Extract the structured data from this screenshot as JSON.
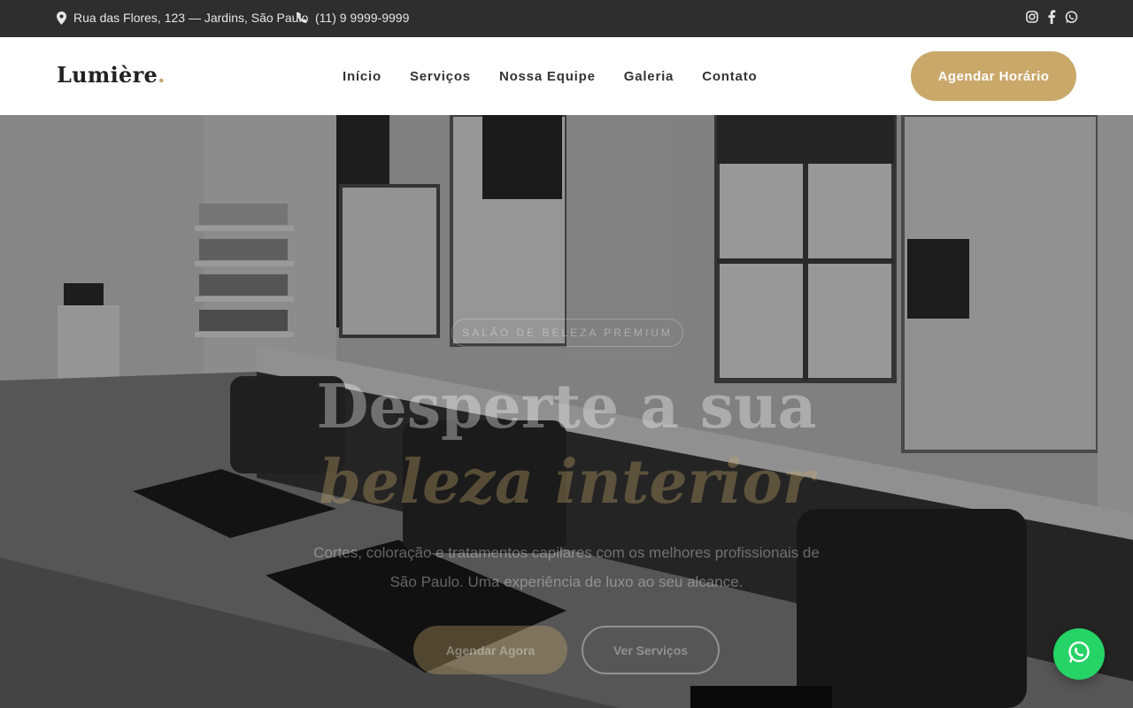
{
  "topbar": {
    "address": "Rua das Flores, 123 — Jardins, São Paulo",
    "phone": "(11) 9 9999-9999",
    "socials": [
      "instagram-icon",
      "facebook-icon",
      "whatsapp-icon"
    ]
  },
  "header": {
    "logo_text": "Lumière",
    "logo_dot": ".",
    "nav": [
      {
        "label": "Início"
      },
      {
        "label": "Serviços"
      },
      {
        "label": "Nossa Equipe"
      },
      {
        "label": "Galeria"
      },
      {
        "label": "Contato"
      }
    ],
    "cta_label": "Agendar Horário"
  },
  "hero": {
    "badge": "SALÃO DE BELEZA PREMIUM",
    "title_line1": "Desperte a sua",
    "title_line2": "beleza interior",
    "subtitle": "Cortes, coloração e tratamentos capilares com os melhores profissionais de São Paulo. Uma experiência de luxo ao seu alcance.",
    "primary_button": "Agendar Agora",
    "secondary_button": "Ver Serviços"
  },
  "colors": {
    "accent": "#c9a86a",
    "topbar": "#2e2e2e",
    "whatsapp": "#25d366"
  }
}
